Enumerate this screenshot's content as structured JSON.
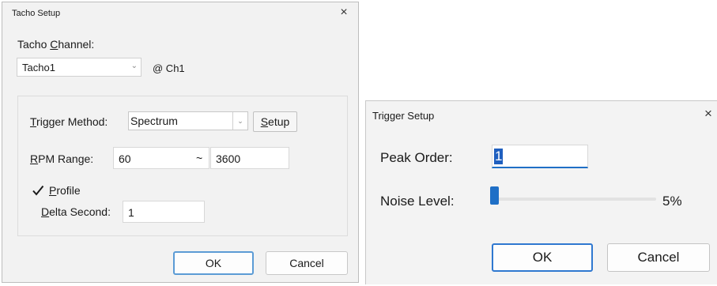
{
  "tacho_dialog": {
    "title": "Tacho Setup",
    "close_glyph": "×",
    "channel_label_pre": "Tacho ",
    "channel_label_key": "C",
    "channel_label_post": "hannel:",
    "channel_value": "Tacho1",
    "channel_suffix": "@ Ch1",
    "trigger_label_key": "T",
    "trigger_label_post": "rigger Method:",
    "trigger_value": "Spectrum",
    "setup_key": "S",
    "setup_post": "etup",
    "rpm_label_key": "R",
    "rpm_label_post": "PM Range:",
    "rpm_min": "60",
    "rpm_separator": "~",
    "rpm_max": "3600",
    "profile_checked": true,
    "profile_key": "P",
    "profile_post": "rofile",
    "delta_key": "D",
    "delta_post": "elta Second:",
    "delta_value": "1",
    "ok_label": "OK",
    "cancel_label": "Cancel"
  },
  "trigger_dialog": {
    "title": "Trigger Setup",
    "close_glyph": "×",
    "peak_label": "Peak Order:",
    "peak_value": "1",
    "noise_label": "Noise Level:",
    "noise_percent": 5,
    "noise_text": "5%",
    "ok_label": "OK",
    "cancel_label": "Cancel"
  },
  "colors": {
    "accent": "#1f6fc6",
    "dialog_bg": "#f2f2f2"
  }
}
